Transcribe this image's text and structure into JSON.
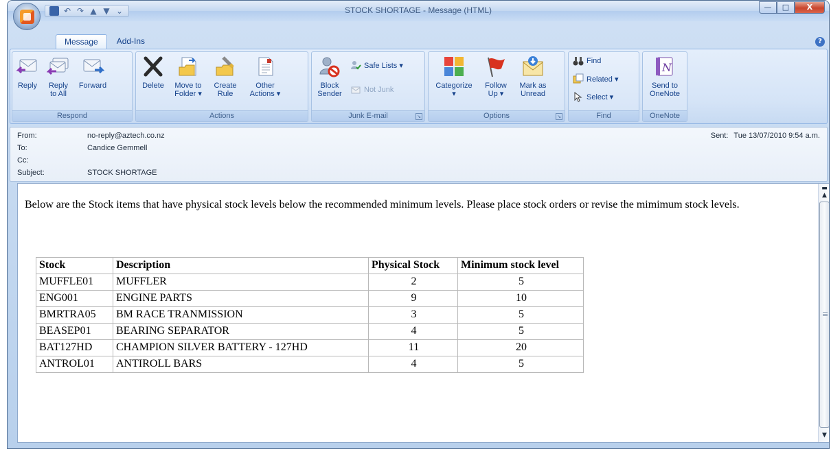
{
  "window": {
    "title": "STOCK SHORTAGE  - Message (HTML)",
    "buttons": [
      "—",
      "□",
      "X"
    ]
  },
  "tabs": [
    "Message",
    "Add-Ins"
  ],
  "ribbon": {
    "respond": {
      "label": "Respond",
      "reply": "Reply",
      "reply_all_1": "Reply",
      "reply_all_2": "to All",
      "forward": "Forward"
    },
    "actions": {
      "label": "Actions",
      "delete": "Delete",
      "move_1": "Move to",
      "move_2": "Folder ▾",
      "rule_1": "Create",
      "rule_2": "Rule",
      "other_1": "Other",
      "other_2": "Actions ▾"
    },
    "junk": {
      "label": "Junk E-mail",
      "block_1": "Block",
      "block_2": "Sender",
      "safe_lists": "Safe Lists ▾",
      "not_junk": "Not Junk"
    },
    "options": {
      "label": "Options",
      "categorize_1": "Categorize",
      "categorize_2": "▾",
      "follow_1": "Follow",
      "follow_2": "Up ▾",
      "mark_1": "Mark as",
      "mark_2": "Unread"
    },
    "find": {
      "label": "Find",
      "find": "Find",
      "related": "Related ▾",
      "select": "Select ▾"
    },
    "onenote": {
      "label": "OneNote",
      "send_1": "Send to",
      "send_2": "OneNote"
    }
  },
  "header": {
    "from_label": "From:",
    "from": "no-reply@aztech.co.nz",
    "to_label": "To:",
    "to": "Candice Gemmell",
    "cc_label": "Cc:",
    "cc": "",
    "subject_label": "Subject:",
    "subject": "STOCK SHORTAGE",
    "sent_label": "Sent:",
    "sent": "Tue 13/07/2010 9:54 a.m."
  },
  "message": {
    "intro": "Below are the Stock items that have physical stock levels below the recommended minimum levels. Please place stock orders or revise the mimimum stock levels.",
    "columns": [
      "Stock",
      "Description",
      "Physical Stock",
      "Minimum stock level"
    ],
    "rows": [
      [
        "MUFFLE01",
        "MUFFLER",
        "2",
        "5"
      ],
      [
        "ENG001",
        "ENGINE PARTS",
        "9",
        "10"
      ],
      [
        "BMRTRA05",
        "BM RACE TRANMISSION",
        "3",
        "5"
      ],
      [
        "BEASEP01",
        "BEARING SEPARATOR",
        "4",
        "5"
      ],
      [
        "BAT127HD",
        "CHAMPION SILVER BATTERY - 127HD",
        "11",
        "20"
      ],
      [
        "ANTROL01",
        "ANTIROLL BARS",
        "4",
        "5"
      ]
    ]
  },
  "colors": {
    "ribbon_text": "#15428b",
    "close_button": "#c9452d",
    "frame": "#4f6d93"
  }
}
